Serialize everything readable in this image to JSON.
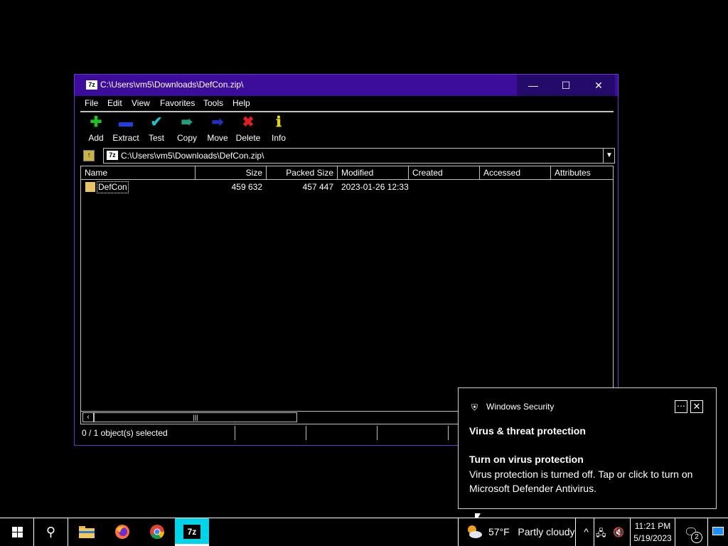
{
  "window": {
    "title": "C:\\Users\\vm5\\Downloads\\DefCon.zip\\",
    "app_icon": "7z",
    "controls": {
      "minimize": "—",
      "maximize": "☐",
      "close": "✕"
    }
  },
  "menu": [
    "File",
    "Edit",
    "View",
    "Favorites",
    "Tools",
    "Help"
  ],
  "toolbar": [
    {
      "label": "Add",
      "icon": "plus-icon",
      "color": "#22c022"
    },
    {
      "label": "Extract",
      "icon": "minus-icon",
      "color": "#2040e0"
    },
    {
      "label": "Test",
      "icon": "check-icon",
      "color": "#20c0c8"
    },
    {
      "label": "Copy",
      "icon": "double-arrow-icon",
      "color": "#20a080"
    },
    {
      "label": "Move",
      "icon": "arrow-right-icon",
      "color": "#2030c0"
    },
    {
      "label": "Delete",
      "icon": "x-icon",
      "color": "#e02020"
    },
    {
      "label": "Info",
      "icon": "info-icon",
      "color": "#e0d020"
    }
  ],
  "address": {
    "value": "C:\\Users\\vm5\\Downloads\\DefCon.zip\\"
  },
  "columns": [
    "Name",
    "Size",
    "Packed Size",
    "Modified",
    "Created",
    "Accessed",
    "Attributes"
  ],
  "rows": [
    {
      "name": "DefCon",
      "size": "459 632",
      "packed": "457 447",
      "modified": "2023-01-26 12:33",
      "created": "",
      "accessed": "",
      "attributes": ""
    }
  ],
  "status": {
    "selection": "0 / 1 object(s) selected"
  },
  "toast": {
    "app": "Windows Security",
    "heading": "Virus & threat protection",
    "subheading": "Turn on virus protection",
    "body": "Virus protection is turned off. Tap or click to turn on Microsoft Defender Antivirus."
  },
  "taskbar": {
    "weather": {
      "temp": "57°F",
      "condition": "Partly cloudy"
    },
    "clock": {
      "time": "11:21 PM",
      "date": "5/19/2023"
    },
    "notification_count": "2",
    "accent": "#00d4e8"
  }
}
